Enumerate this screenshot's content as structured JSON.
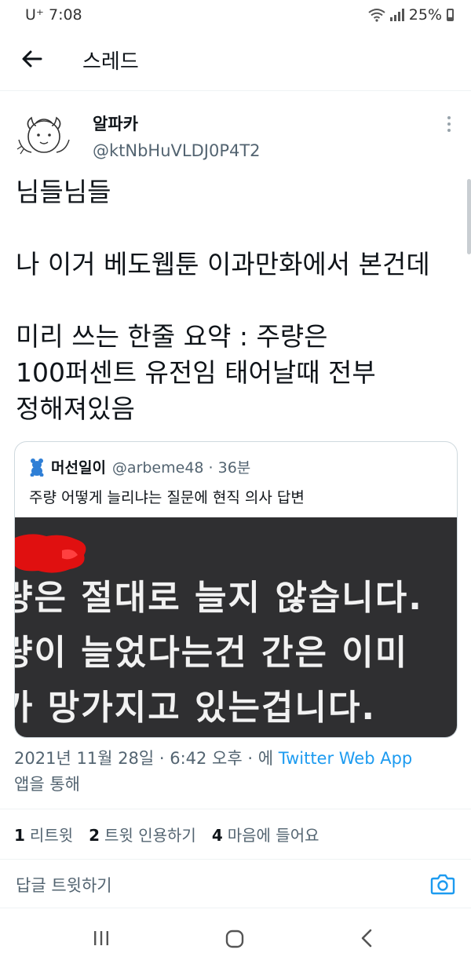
{
  "status_bar": {
    "carrier": "U⁺ 7:08",
    "battery": "25%"
  },
  "header": {
    "title": "스레드"
  },
  "tweet": {
    "display_name": "알파카",
    "handle": "@ktNbHuVLDJ0P4T2",
    "text": "님들님들\n\n나 이거 베도웹툰 이과만화에서 본건데\n\n미리 쓰는 한줄 요약 : 주량은\n100퍼센트 유전임 태어날때 전부\n정해져있음",
    "timestamp": "2021년 11월 28일 · 6:42 오후 · 에 ",
    "source": "Twitter Web App",
    "source_suffix": "앱을 통해"
  },
  "quote": {
    "name": "머선일이",
    "meta": "@arbeme48 · 36분",
    "text": "주량 어떻게 늘리냐는 질문에 현직 의사 답변",
    "image_lines": [
      "량은 절대로 늘지 않습니다.",
      "량이 늘었다는건 간은 이미",
      "가 망가지고 있는겁니다."
    ]
  },
  "stats": {
    "retweets_count": "1",
    "retweets_label": "리트윗",
    "quotes_count": "2",
    "quotes_label": "트윗 인용하기",
    "likes_count": "4",
    "likes_label": "마음에 들어요"
  },
  "reply": {
    "placeholder": "답글 트윗하기"
  },
  "colors": {
    "link": "#1d9bf0",
    "secondary_text": "#536471",
    "image_background": "#2f2f31"
  }
}
